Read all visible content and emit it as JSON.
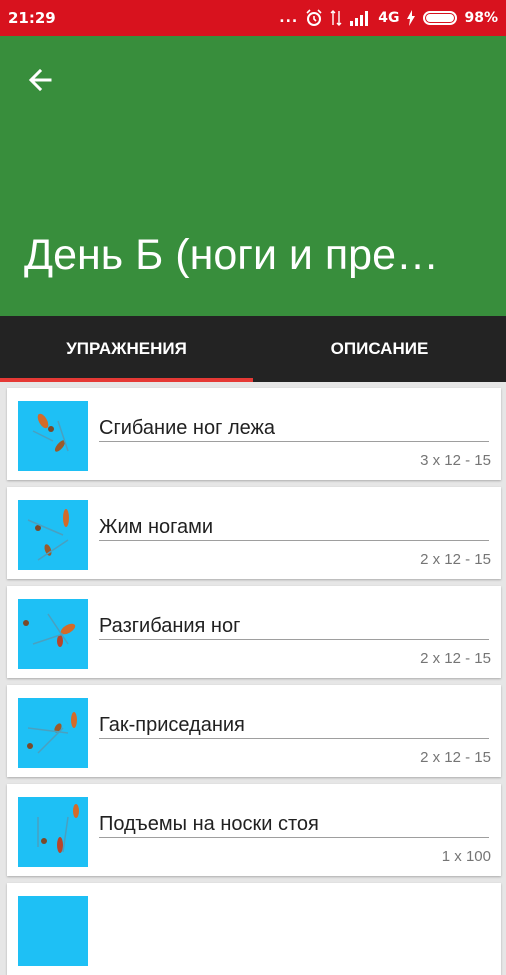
{
  "status": {
    "time": "21:29",
    "dots": "...",
    "network": "4G",
    "battery_percent": "98%",
    "battery_level": 0.98
  },
  "header": {
    "title": "День Б (ноги и пре…"
  },
  "tabs": [
    {
      "label": "УПРАЖНЕНИЯ",
      "active": true
    },
    {
      "label": "ОПИСАНИЕ",
      "active": false
    }
  ],
  "colors": {
    "status_bar": "#d8121e",
    "app_bar": "#388e3c",
    "tab_bar": "#232323",
    "tab_indicator": "#e53935",
    "thumbnail_bg": "#1ec0f5"
  },
  "exercises": [
    {
      "name": "Сгибание ног лежа",
      "sets": "3 x 12 - 15"
    },
    {
      "name": "Жим ногами",
      "sets": "2 x 12 - 15"
    },
    {
      "name": "Разгибания ног",
      "sets": "2 x 12 - 15"
    },
    {
      "name": "Гак-приседания",
      "sets": "2 x 12 - 15"
    },
    {
      "name": "Подъемы на носки стоя",
      "sets": "1 x 100"
    }
  ]
}
